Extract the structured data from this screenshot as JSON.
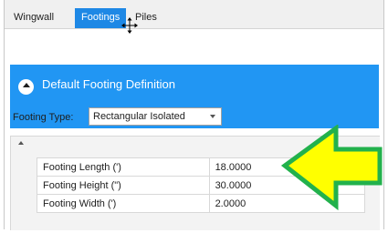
{
  "tabs": [
    {
      "label": "Wingwall",
      "active": false
    },
    {
      "label": "Footings",
      "active": true
    },
    {
      "label": "Piles",
      "active": false
    }
  ],
  "section": {
    "title": "Default Footing Definition",
    "footing_type_label": "Footing Type:",
    "footing_type_value": "Rectangular Isolated"
  },
  "properties": [
    {
      "name": "Footing Length (')",
      "value": "18.0000"
    },
    {
      "name": "Footing Height (\")",
      "value": "30.0000"
    },
    {
      "name": "Footing Width (')",
      "value": "2.0000"
    }
  ],
  "colors": {
    "accent": "#2196f3",
    "active_tab": "#1e88e5",
    "callout_fill": "#ffff00",
    "callout_stroke": "#22b14c"
  },
  "icons": [
    "collapse-chevron-up-icon",
    "dropdown-arrow-icon",
    "move-cursor-icon",
    "expand-arrow-icon",
    "callout-arrow-icon"
  ]
}
